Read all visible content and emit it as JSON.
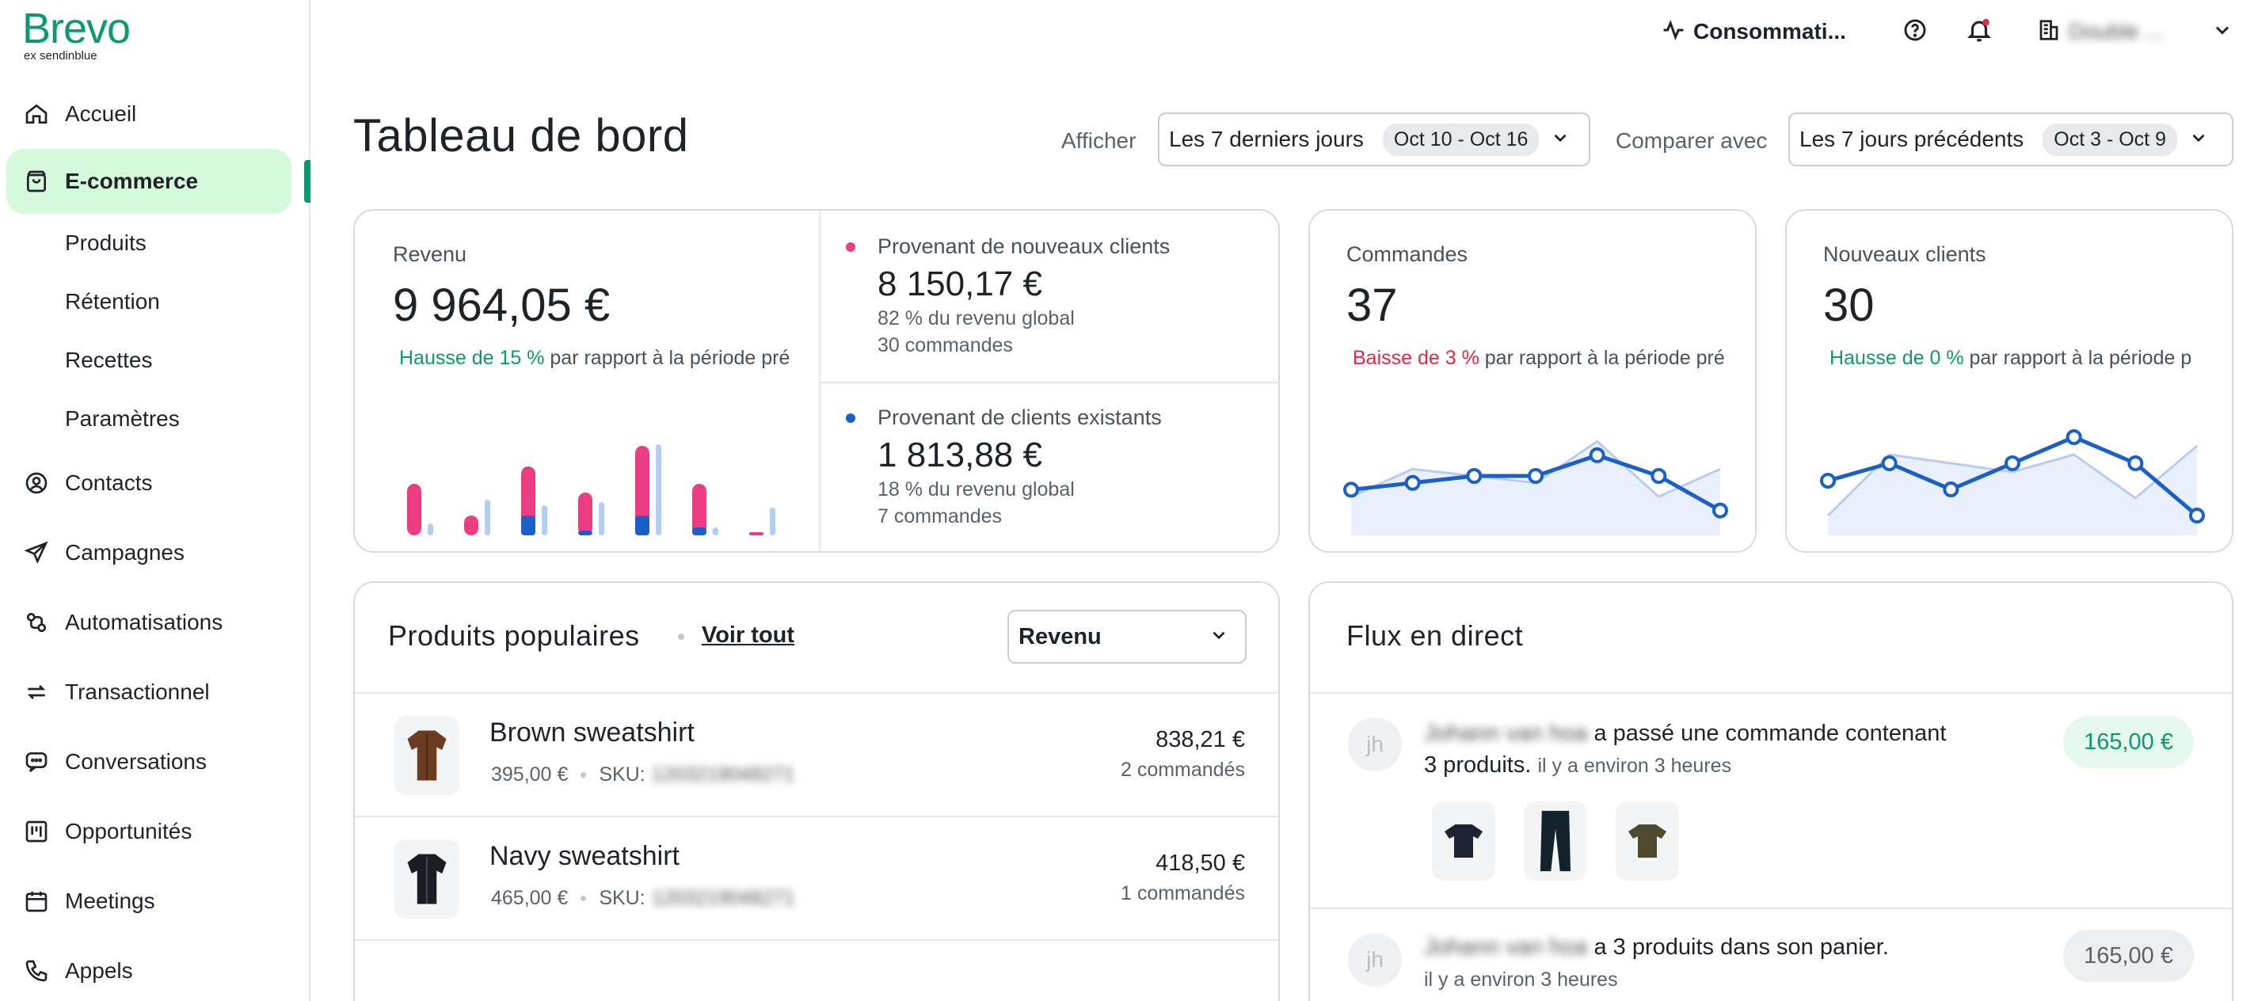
{
  "brand": {
    "name": "Brevo",
    "tagline": "ex sendinblue",
    "color": "#0b996e"
  },
  "sidebar": {
    "items": [
      {
        "label": "Accueil",
        "icon": "home-icon"
      },
      {
        "label": "E-commerce",
        "icon": "shopping-bag-icon",
        "active": true
      },
      {
        "label": "Contacts",
        "icon": "contact-icon"
      },
      {
        "label": "Campagnes",
        "icon": "send-icon"
      },
      {
        "label": "Automatisations",
        "icon": "automation-icon"
      },
      {
        "label": "Transactionnel",
        "icon": "transfer-icon"
      },
      {
        "label": "Conversations",
        "icon": "chat-icon"
      },
      {
        "label": "Opportunités",
        "icon": "board-icon"
      },
      {
        "label": "Meetings",
        "icon": "calendar-icon"
      },
      {
        "label": "Appels",
        "icon": "phone-icon"
      }
    ],
    "subitems": [
      "Produits",
      "Rétention",
      "Recettes",
      "Paramètres"
    ]
  },
  "topbar": {
    "usage_label": "Consommati...",
    "account_name": "Double ..."
  },
  "header": {
    "title": "Tableau de bord",
    "show_label": "Afficher",
    "period_value": "Les 7 derniers jours",
    "period_range": "Oct 10 - Oct 16",
    "compare_label": "Comparer avec",
    "compare_value": "Les 7 jours précédents",
    "compare_range": "Oct 3 - Oct 9"
  },
  "revenue": {
    "label": "Revenu",
    "value": "9 964,05 €",
    "trend_strong": "Hausse de 15 %",
    "trend_rest": " par rapport à la période pré",
    "new_clients_label": "Provenant de nouveaux clients",
    "new_clients_value": "8 150,17 €",
    "new_clients_share": "82 % du revenu global",
    "new_clients_orders": "30 commandes",
    "existing_clients_label": "Provenant de clients existants",
    "existing_clients_value": "1 813,88 €",
    "existing_clients_share": "18 % du revenu global",
    "existing_clients_orders": "7 commandes",
    "colors": {
      "new": "#ec3d82",
      "existing": "#1b5fc8",
      "previous": "#b7cdf0"
    }
  },
  "orders": {
    "label": "Commandes",
    "value": "37",
    "trend_strong": "Baisse de 3 %",
    "trend_rest": " par rapport à la période pré"
  },
  "new_customers": {
    "label": "Nouveaux clients",
    "value": "30",
    "trend_strong": "Hausse de 0 %",
    "trend_rest": " par rapport à la période p"
  },
  "chart_data": [
    {
      "type": "bar",
      "categories": [
        "1",
        "2",
        "3",
        "4",
        "5",
        "6",
        "7"
      ],
      "series": [
        {
          "values": [
            65,
            25,
            62,
            48,
            88,
            55,
            3
          ]
        },
        {
          "values": [
            0,
            0,
            25,
            6,
            25,
            10,
            0
          ]
        },
        {
          "values": [
            15,
            45,
            38,
            42,
            115,
            10,
            35
          ]
        }
      ],
      "ylim": [
        0,
        125
      ]
    },
    {
      "type": "line",
      "categories": [
        "1",
        "2",
        "3",
        "4",
        "5",
        "6",
        "7"
      ],
      "series": [
        {
          "values": [
            5,
            6,
            7,
            7,
            10,
            7,
            2
          ]
        },
        {
          "values": [
            4,
            8,
            7,
            6,
            12,
            4,
            8
          ]
        }
      ],
      "ylim": [
        0,
        14
      ]
    },
    {
      "type": "line",
      "categories": [
        "1",
        "2",
        "3",
        "4",
        "5",
        "6",
        "7"
      ],
      "series": [
        {
          "values": [
            5,
            7,
            4,
            7,
            10,
            7,
            1
          ]
        },
        {
          "values": [
            1,
            8,
            7,
            6,
            8,
            3,
            9
          ]
        }
      ],
      "ylim": [
        0,
        12
      ]
    }
  ],
  "popular_products": {
    "title": "Produits populaires",
    "view_all": "Voir tout",
    "sort_value": "Revenu",
    "items": [
      {
        "name": "Brown sweatshirt",
        "price": "395,00 €",
        "sku_label": "SKU:",
        "sku": "1203219048271",
        "revenue": "838,21 €",
        "orders": "2 commandés",
        "color": "#6b3b22"
      },
      {
        "name": "Navy sweatshirt",
        "price": "465,00 €",
        "sku_label": "SKU:",
        "sku": "1203219048271",
        "revenue": "418,50 €",
        "orders": "1 commandés",
        "color": "#1a1d24"
      }
    ]
  },
  "live_feed": {
    "title": "Flux en direct",
    "items": [
      {
        "initials": "jh",
        "name": "Johann van hoa",
        "text_a": "a passé une commande contenant",
        "text_b": "3 produits.",
        "time": "il y a environ 3 heures",
        "amount": "165,00 €"
      },
      {
        "initials": "jh",
        "name": "Johann van hoa",
        "text_a": "a 3 produits dans son panier.",
        "time": "il y a environ 3 heures",
        "amount": "165,00 €"
      }
    ]
  }
}
